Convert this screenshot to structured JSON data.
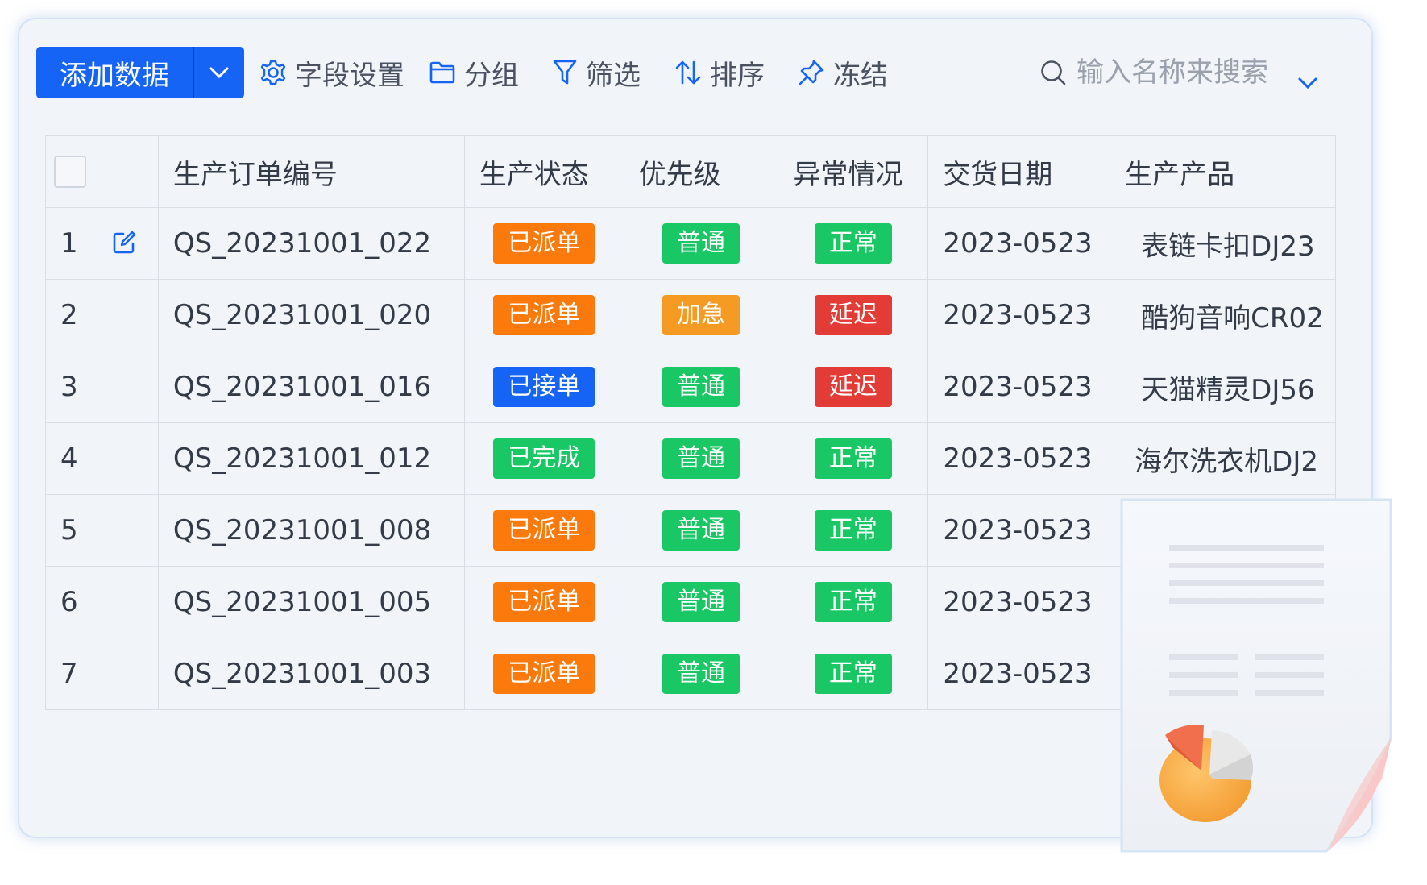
{
  "toolbar": {
    "add_label": "添加数据",
    "field_settings": "字段设置",
    "group": "分组",
    "filter": "筛选",
    "sort": "排序",
    "freeze": "冻结",
    "search_placeholder": "输入名称来搜索"
  },
  "colors": {
    "primary": "#1664f5",
    "orange": "#fb7a0b",
    "green": "#19c765",
    "red": "#e33b35",
    "amber": "#f59a23"
  },
  "table": {
    "headers": [
      "生产订单编号",
      "生产状态",
      "优先级",
      "异常情况",
      "交货日期",
      "生产产品"
    ],
    "rows": [
      {
        "index": "1",
        "order": "QS_20231001_022",
        "status": "已派单",
        "priority": "普通",
        "exception": "正常",
        "date": "2023-0523",
        "product": "表链卡扣DJ23"
      },
      {
        "index": "2",
        "order": "QS_20231001_020",
        "status": "已派单",
        "priority": "加急",
        "exception": "延迟",
        "date": "2023-0523",
        "product": "酷狗音响CR02"
      },
      {
        "index": "3",
        "order": "QS_20231001_016",
        "status": "已接单",
        "priority": "普通",
        "exception": "延迟",
        "date": "2023-0523",
        "product": "天猫精灵DJ56"
      },
      {
        "index": "4",
        "order": "QS_20231001_012",
        "status": "已完成",
        "priority": "普通",
        "exception": "正常",
        "date": "2023-0523",
        "product": "海尔洗衣机DJ2"
      },
      {
        "index": "5",
        "order": "QS_20231001_008",
        "status": "已派单",
        "priority": "普通",
        "exception": "正常",
        "date": "2023-0523",
        "product": ""
      },
      {
        "index": "6",
        "order": "QS_20231001_005",
        "status": "已派单",
        "priority": "普通",
        "exception": "正常",
        "date": "2023-0523",
        "product": ""
      },
      {
        "index": "7",
        "order": "QS_20231001_003",
        "status": "已派单",
        "priority": "普通",
        "exception": "正常",
        "date": "2023-0523",
        "product": ""
      }
    ]
  },
  "badge_colors": {
    "已派单": "#fb7a0b",
    "已接单": "#1664f5",
    "已完成": "#19c765",
    "普通": "#19c765",
    "加急": "#f59a23",
    "正常": "#19c765",
    "延迟": "#e33b35"
  }
}
